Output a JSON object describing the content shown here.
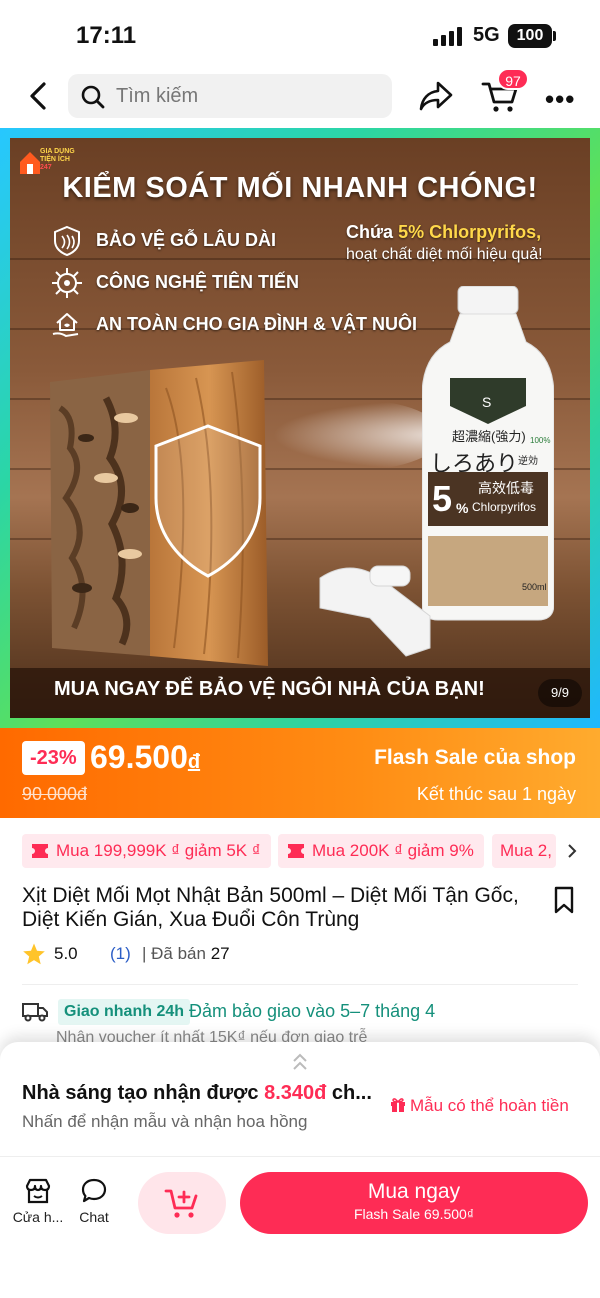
{
  "status_bar": {
    "time": "17:11",
    "network": "5G",
    "battery": "100"
  },
  "nav": {
    "search_placeholder": "Tìm kiếm",
    "cart_count": "97"
  },
  "hero": {
    "brand": [
      "GIA DỤNG",
      "TIỆN ÍCH",
      "247"
    ],
    "title": "KIỂM SOÁT MỐI NHANH CHÓNG!",
    "features": [
      "BẢO VỆ GỖ LÂU DÀI",
      "CÔNG NGHỆ TIÊN TIẾN",
      "AN TOÀN CHO GIA ĐÌNH & VẬT NUÔI"
    ],
    "chem_prefix": "Chứa",
    "chem_highlight": "5% Chlorpyrifos,",
    "chem_desc": "hoạt chất diệt mối hiệu quả!",
    "bottle_label": {
      "kanji1": "超濃縮(強力)",
      "kana": "しろあり",
      "small": "逆効",
      "percent": "5",
      "pct_sign": "%",
      "kanji2": "高效低毒",
      "chem": "Chlorpyrifos",
      "badge": "100%",
      "volume": "500ml",
      "s_mark": "S"
    },
    "bottom_text": "MUA NGAY ĐỂ BẢO VỆ NGÔI NHÀ CỦA BẠN!",
    "counter": "9/9"
  },
  "flash_sale": {
    "discount": "-23%",
    "price": "69.500",
    "currency": "đ",
    "old_price": "90.000đ",
    "title": "Flash Sale của shop",
    "ends": "Kết thúc sau 1 ngày"
  },
  "vouchers": [
    "Mua 199,999K ₫ giảm 5K ₫",
    "Mua 200K ₫ giảm 9%",
    "Mua 2,"
  ],
  "product": {
    "title": "Xịt Diệt Mối Mọt Nhật Bản 500ml – Diệt Mối Tận Gốc, Diệt Kiến Gián, Xua Đuổi Côn Trùng",
    "rating": "5.0",
    "rating_count": "(1)",
    "sold_label": "Đã bán",
    "sold_count": "27"
  },
  "shipping": {
    "badge": "Giao nhanh 24h",
    "text": "Đảm bảo giao vào 5–7 tháng 4",
    "sub": "Nhận voucher ít nhất 15K₫ nếu đơn giao trễ"
  },
  "creator": {
    "title_prefix": "Nhà sáng tạo nhận được",
    "amount": "8.340đ",
    "title_suffix": "ch...",
    "subtitle": "Nhấn để nhận mẫu và nhận hoa hồng",
    "link": "Mẫu có thể hoàn tiền"
  },
  "bottom_bar": {
    "shop_label": "Cửa h...",
    "chat_label": "Chat",
    "buy_label": "Mua ngay",
    "buy_sub": "Flash Sale 69.500₫"
  },
  "colors": {
    "accent": "#fe2c55",
    "flash": "#ff7a0a",
    "ship": "#15907b"
  }
}
